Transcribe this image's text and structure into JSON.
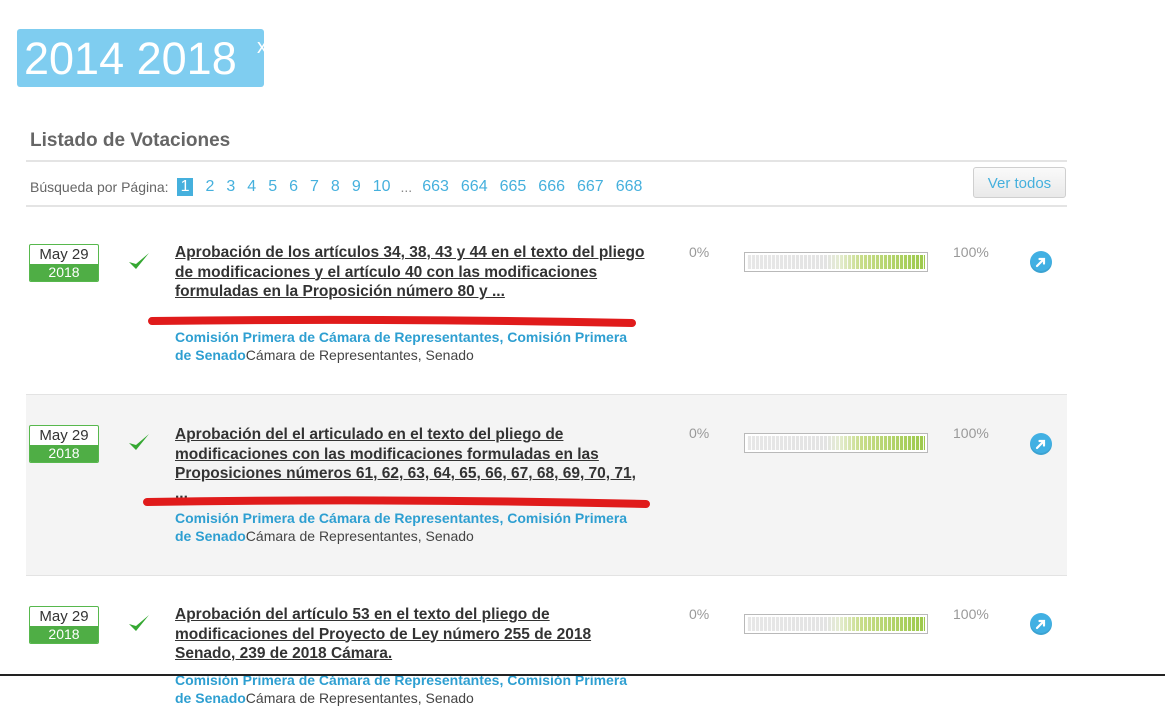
{
  "filter_tag": {
    "text": "2014 2018",
    "close": "x"
  },
  "section_title": "Listado de Votaciones",
  "pagination": {
    "label": "Búsqueda por Página:",
    "pages_start": [
      "1",
      "2",
      "3",
      "4",
      "5",
      "6",
      "7",
      "8",
      "9",
      "10"
    ],
    "ellipsis": "...",
    "pages_end": [
      "663",
      "664",
      "665",
      "666",
      "667",
      "668"
    ],
    "current": "1"
  },
  "ver_todos_label": "Ver todos",
  "votes": [
    {
      "date": "May 29",
      "year": "2018",
      "title": "Aprobación de los artículos 34, 38, 43 y 44 en el texto del pliego de modificaciones y el artículo 40 con las modificaciones formuladas en la Proposición número 80 y ...",
      "commission": "Comisión Primera de Cámara de Representantes, Comisión Primera de Senado",
      "chamber": "Cámara de Representantes, Senado",
      "pct_min": "0%",
      "pct_max": "100%"
    },
    {
      "date": "May 29",
      "year": "2018",
      "title": "Aprobación del el articulado en el texto del pliego de modificaciones con las modificaciones formuladas en las Proposiciones números 61, 62, 63, 64, 65, 66, 67, 68, 69, 70, 71, ...",
      "commission": "Comisión Primera de Cámara de Representantes, Comisión Primera de Senado",
      "chamber": "Cámara de Representantes, Senado",
      "pct_min": "0%",
      "pct_max": "100%"
    },
    {
      "date": "May 29",
      "year": "2018",
      "title": "Aprobación del artículo 53 en el texto del pliego de modificaciones del Proyecto de Ley número 255 de 2018 Senado, 239 de 2018 Cámara.",
      "commission": "Comisión Primera de Cámara de Representantes, Comisión Primera de Senado",
      "chamber": "Cámara de Representantes, Senado",
      "pct_min": "0%",
      "pct_max": "100%"
    }
  ],
  "colors": {
    "accent": "#45b0dd",
    "tag": "#7fcdf0",
    "date_green": "#4fae45",
    "annotation_red": "#e01b1b"
  }
}
